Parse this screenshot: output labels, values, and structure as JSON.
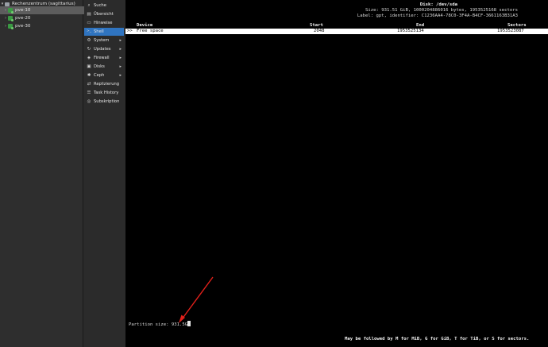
{
  "tree": {
    "datacenter": "Rechenzentrum (sagittarius)",
    "nodes": [
      {
        "label": "pve-10",
        "selected": true
      },
      {
        "label": "pve-20",
        "selected": false
      },
      {
        "label": "pve-30",
        "selected": false
      }
    ]
  },
  "menu": {
    "items": [
      {
        "label": "Suche",
        "icon": "search-icon",
        "glyph": "🔍",
        "submenu": false
      },
      {
        "label": "Übersicht",
        "icon": "summary-icon",
        "glyph": "▤",
        "submenu": false
      },
      {
        "label": "Hinweise",
        "icon": "notes-icon",
        "glyph": "▭",
        "submenu": false
      },
      {
        "label": "Shell",
        "icon": "terminal-icon",
        "glyph": ">_",
        "submenu": false,
        "active": true
      },
      {
        "label": "System",
        "icon": "gear-icon",
        "glyph": "⚙",
        "submenu": true
      },
      {
        "label": "Updates",
        "icon": "refresh-icon",
        "glyph": "↻",
        "submenu": true
      },
      {
        "label": "Firewall",
        "icon": "shield-icon",
        "glyph": "◈",
        "submenu": true
      },
      {
        "label": "Disks",
        "icon": "disk-icon",
        "glyph": "▣",
        "submenu": true
      },
      {
        "label": "Ceph",
        "icon": "ceph-icon",
        "glyph": "✱",
        "submenu": true
      },
      {
        "label": "Replizierung",
        "icon": "replication-icon",
        "glyph": "⇄",
        "submenu": false
      },
      {
        "label": "Task History",
        "icon": "list-icon",
        "glyph": "☰",
        "submenu": false
      },
      {
        "label": "Subskription",
        "icon": "support-icon",
        "glyph": "◎",
        "submenu": false
      }
    ]
  },
  "terminal": {
    "disk_title": "Disk: /dev/sda",
    "size_line": "Size: 931.51 GiB, 1000204886016 bytes, 1953525168 sectors",
    "label_line": "Label: gpt, identifier: C1236AA4-78C0-3F4A-B4CF-3661163B31A3",
    "columns": {
      "device": "Device",
      "start": "Start",
      "end": "End",
      "sectors": "Sectors"
    },
    "row": {
      "marker": ">>",
      "device": "Free space",
      "start": "2048",
      "end": "1953525134",
      "sectors": "1953523087"
    },
    "prompt_label": "Partition size:",
    "prompt_value": "931.5G",
    "hint": "May be followed by M for MiB, G for GiB, T for TiB, or S for sectors."
  },
  "annotation": {
    "color": "#e0201a"
  }
}
